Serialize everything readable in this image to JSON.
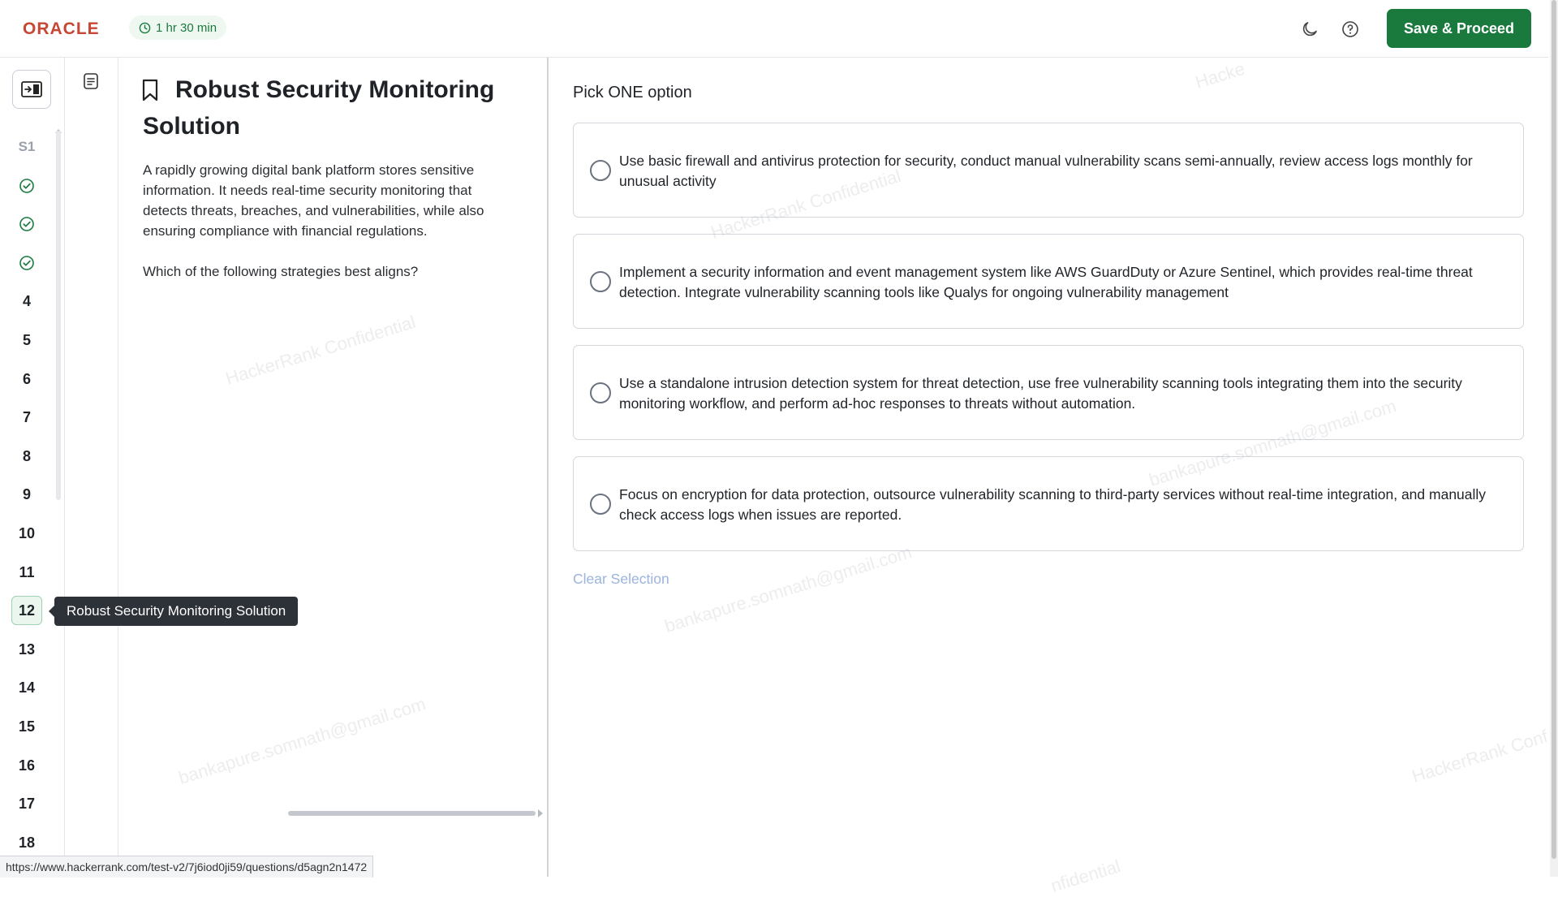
{
  "header": {
    "logo": "ORACLE",
    "timer": "1 hr 30 min",
    "save_label": "Save & Proceed"
  },
  "nav": {
    "items": [
      {
        "label": "S1",
        "kind": "section"
      },
      {
        "label": "",
        "kind": "completed",
        "icon": "check-circle-icon"
      },
      {
        "label": "",
        "kind": "completed",
        "icon": "check-circle-icon"
      },
      {
        "label": "",
        "kind": "completed",
        "icon": "check-circle-icon"
      },
      {
        "label": "4",
        "kind": "question"
      },
      {
        "label": "5",
        "kind": "question"
      },
      {
        "label": "6",
        "kind": "question"
      },
      {
        "label": "7",
        "kind": "question"
      },
      {
        "label": "8",
        "kind": "question"
      },
      {
        "label": "9",
        "kind": "question"
      },
      {
        "label": "10",
        "kind": "question"
      },
      {
        "label": "11",
        "kind": "question"
      },
      {
        "label": "12",
        "kind": "active"
      },
      {
        "label": "13",
        "kind": "question"
      },
      {
        "label": "14",
        "kind": "question"
      },
      {
        "label": "15",
        "kind": "question"
      },
      {
        "label": "16",
        "kind": "question"
      },
      {
        "label": "17",
        "kind": "question"
      },
      {
        "label": "18",
        "kind": "question"
      }
    ],
    "tooltip": "Robust Security Monitoring Solution"
  },
  "question": {
    "title": "Robust Security Monitoring Solution",
    "paragraphs": [
      "A rapidly growing digital bank platform stores sensitive information. It needs real-time security monitoring that detects threats, breaches, and vulnerabilities, while also ensuring compliance with financial regulations.",
      "Which of the following strategies best aligns?"
    ]
  },
  "answers": {
    "instruction": "Pick ONE option",
    "options": [
      "Use basic firewall and antivirus protection for security, conduct manual vulnerability scans semi-annually, review access logs monthly for unusual activity",
      "Implement a security information and event management system like AWS GuardDuty or Azure Sentinel, which provides real-time threat detection. Integrate vulnerability scanning tools like Qualys for ongoing vulnerability management",
      "Use a standalone intrusion detection system for threat detection, use free vulnerability scanning tools integrating them into the security monitoring workflow, and perform ad-hoc responses to threats without automation.",
      "Focus on encryption for data protection, outsource vulnerability scanning to third-party services without real-time integration, and manually check access logs when issues are reported."
    ],
    "clear_label": "Clear Selection"
  },
  "status_url": "https://www.hackerrank.com/test-v2/7j6iod0ji59/questions/d5agn2n1472",
  "watermarks": [
    "HackerRank Confidential",
    "bankapure.somnath@gmail.com",
    "HackerRank Confidential",
    "bankapure.somnath@gmail.com",
    "bankapure.somnath@gmail.com",
    "HackerRank Conf",
    "Hacke",
    "nfidential"
  ],
  "colors": {
    "accent_green": "#1a7a3e",
    "brand_red": "#c74634",
    "link_disabled": "#9bb3dd"
  }
}
